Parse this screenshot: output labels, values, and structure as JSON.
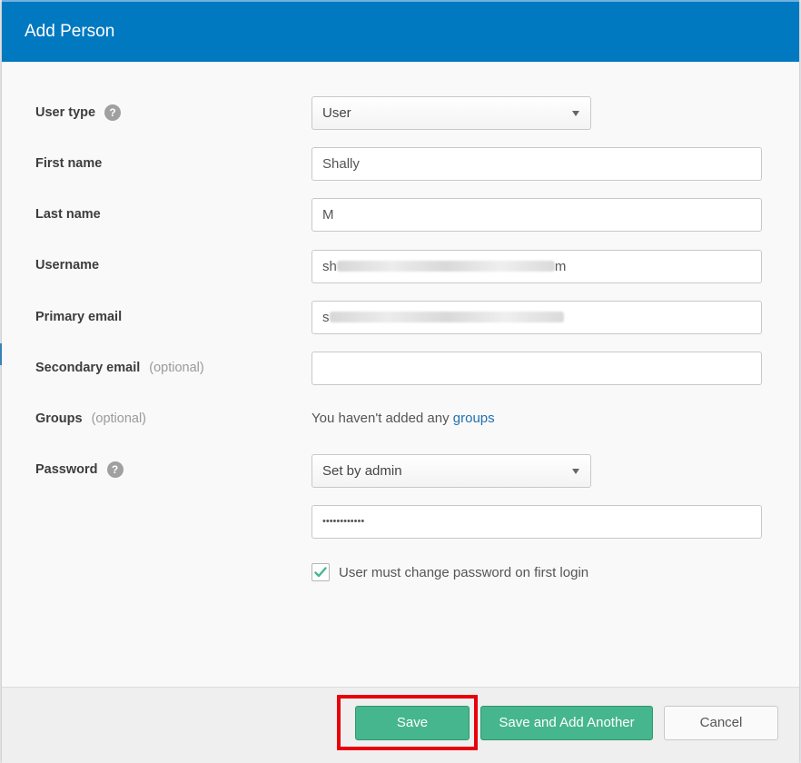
{
  "modal": {
    "title": "Add Person"
  },
  "form": {
    "user_type": {
      "label": "User type",
      "value": "User"
    },
    "first_name": {
      "label": "First name",
      "value": "Shally"
    },
    "last_name": {
      "label": "Last name",
      "value": "M"
    },
    "username": {
      "label": "Username",
      "value_start": "sh",
      "value_end": "m"
    },
    "primary_email": {
      "label": "Primary email",
      "value_start": "s"
    },
    "secondary_email": {
      "label": "Secondary email",
      "optional": "(optional)",
      "value": ""
    },
    "groups": {
      "label": "Groups",
      "optional": "(optional)",
      "text": "You haven't added any ",
      "link": "groups"
    },
    "password": {
      "label": "Password",
      "mode": "Set by admin",
      "masked_value": "••••••••••••"
    },
    "must_change": {
      "label": "User must change password on first login",
      "checked": true
    }
  },
  "footer": {
    "save": "Save",
    "save_add_another": "Save and Add Another",
    "cancel": "Cancel"
  },
  "colors": {
    "header": "#0079c1",
    "primary_button": "#46b68e",
    "highlight": "#e8000c"
  },
  "icons": {
    "help": "question-circle-icon",
    "caret": "caret-down-icon",
    "check": "checkmark-icon"
  }
}
